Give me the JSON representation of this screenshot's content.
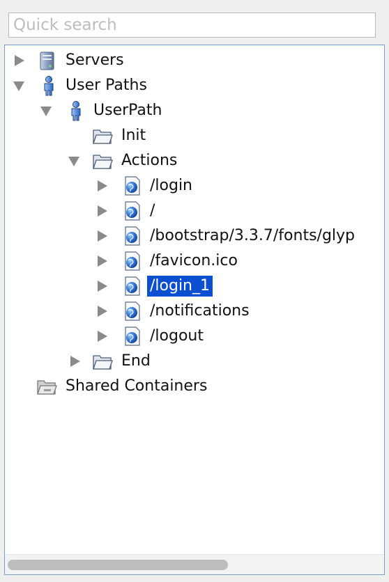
{
  "search": {
    "placeholder": "Quick search",
    "value": ""
  },
  "tree": {
    "servers": {
      "label": "Servers",
      "icon": "server-icon",
      "expanded": false
    },
    "user_paths": {
      "label": "User Paths",
      "icon": "user-icon",
      "expanded": true
    },
    "user_path": {
      "label": "UserPath",
      "icon": "user-icon",
      "expanded": true
    },
    "init": {
      "label": "Init",
      "icon": "folder-icon"
    },
    "actions": {
      "label": "Actions",
      "icon": "folder-icon",
      "expanded": true
    },
    "requests": [
      {
        "label": "/login",
        "icon": "web-page-icon"
      },
      {
        "label": "/",
        "icon": "web-page-icon"
      },
      {
        "label": "/bootstrap/3.3.7/fonts/glyp",
        "icon": "web-page-icon"
      },
      {
        "label": "/favicon.ico",
        "icon": "web-page-icon"
      },
      {
        "label": "/login_1",
        "icon": "web-page-icon",
        "selected": true
      },
      {
        "label": "/notifications",
        "icon": "web-page-icon"
      },
      {
        "label": "/logout",
        "icon": "web-page-icon"
      }
    ],
    "end": {
      "label": "End",
      "icon": "folder-icon",
      "expanded": false
    },
    "shared_containers": {
      "label": "Shared Containers",
      "icon": "shared-folder-icon"
    }
  },
  "colors": {
    "selection": "#0b4fd0",
    "panel_border": "#7a9ec6",
    "background": "#efefef"
  }
}
